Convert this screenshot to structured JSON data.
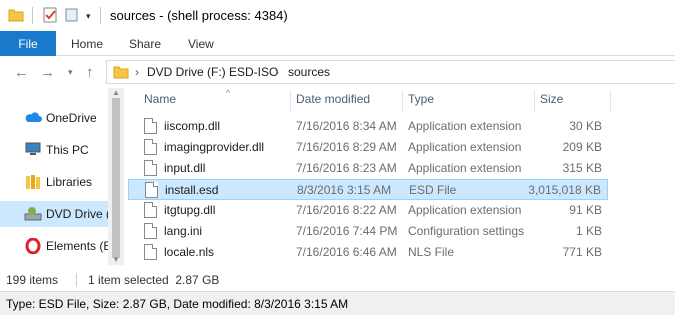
{
  "window": {
    "title": "sources - (shell process: 4384)"
  },
  "ribbon": {
    "tabs": [
      {
        "label": "File"
      },
      {
        "label": "Home"
      },
      {
        "label": "Share"
      },
      {
        "label": "View"
      }
    ]
  },
  "address_bar": {
    "segments": [
      "DVD Drive (F:) ESD-ISO",
      "sources"
    ]
  },
  "nav_pane": {
    "items": [
      {
        "label": "OneDrive",
        "icon": "cloud-icon"
      },
      {
        "label": "This PC",
        "icon": "computer-icon"
      },
      {
        "label": "Libraries",
        "icon": "libraries-icon"
      },
      {
        "label": "DVD Drive (F:)",
        "icon": "dvd-drive-icon",
        "selected": true
      },
      {
        "label": "Elements (E:)",
        "icon": "opera-icon"
      }
    ]
  },
  "file_list": {
    "columns": [
      "Name",
      "Date modified",
      "Type",
      "Size"
    ],
    "rows": [
      {
        "name": "iiscomp.dll",
        "date": "7/16/2016 8:34 AM",
        "type": "Application extension",
        "size": "30 KB"
      },
      {
        "name": "imagingprovider.dll",
        "date": "7/16/2016 8:29 AM",
        "type": "Application extension",
        "size": "209 KB"
      },
      {
        "name": "input.dll",
        "date": "7/16/2016 8:23 AM",
        "type": "Application extension",
        "size": "315 KB"
      },
      {
        "name": "install.esd",
        "date": "8/3/2016 3:15 AM",
        "type": "ESD File",
        "size": "3,015,018 KB",
        "selected": true
      },
      {
        "name": "itgtupg.dll",
        "date": "7/16/2016 8:22 AM",
        "type": "Application extension",
        "size": "91 KB"
      },
      {
        "name": "lang.ini",
        "date": "7/16/2016 7:44 PM",
        "type": "Configuration settings",
        "size": "1 KB"
      },
      {
        "name": "locale.nls",
        "date": "7/16/2016 6:46 AM",
        "type": "NLS File",
        "size": "771 KB"
      }
    ]
  },
  "status_bar": {
    "item_count": "199 items",
    "selection": "1 item selected  2.87 GB"
  },
  "info_bar": {
    "text": "Type: ESD File, Size: 2.87 GB, Date modified: 8/3/2016 3:15 AM"
  },
  "colors": {
    "accent": "#1979ca",
    "selection": "#cce8ff",
    "selection_border": "#99d1ff"
  }
}
